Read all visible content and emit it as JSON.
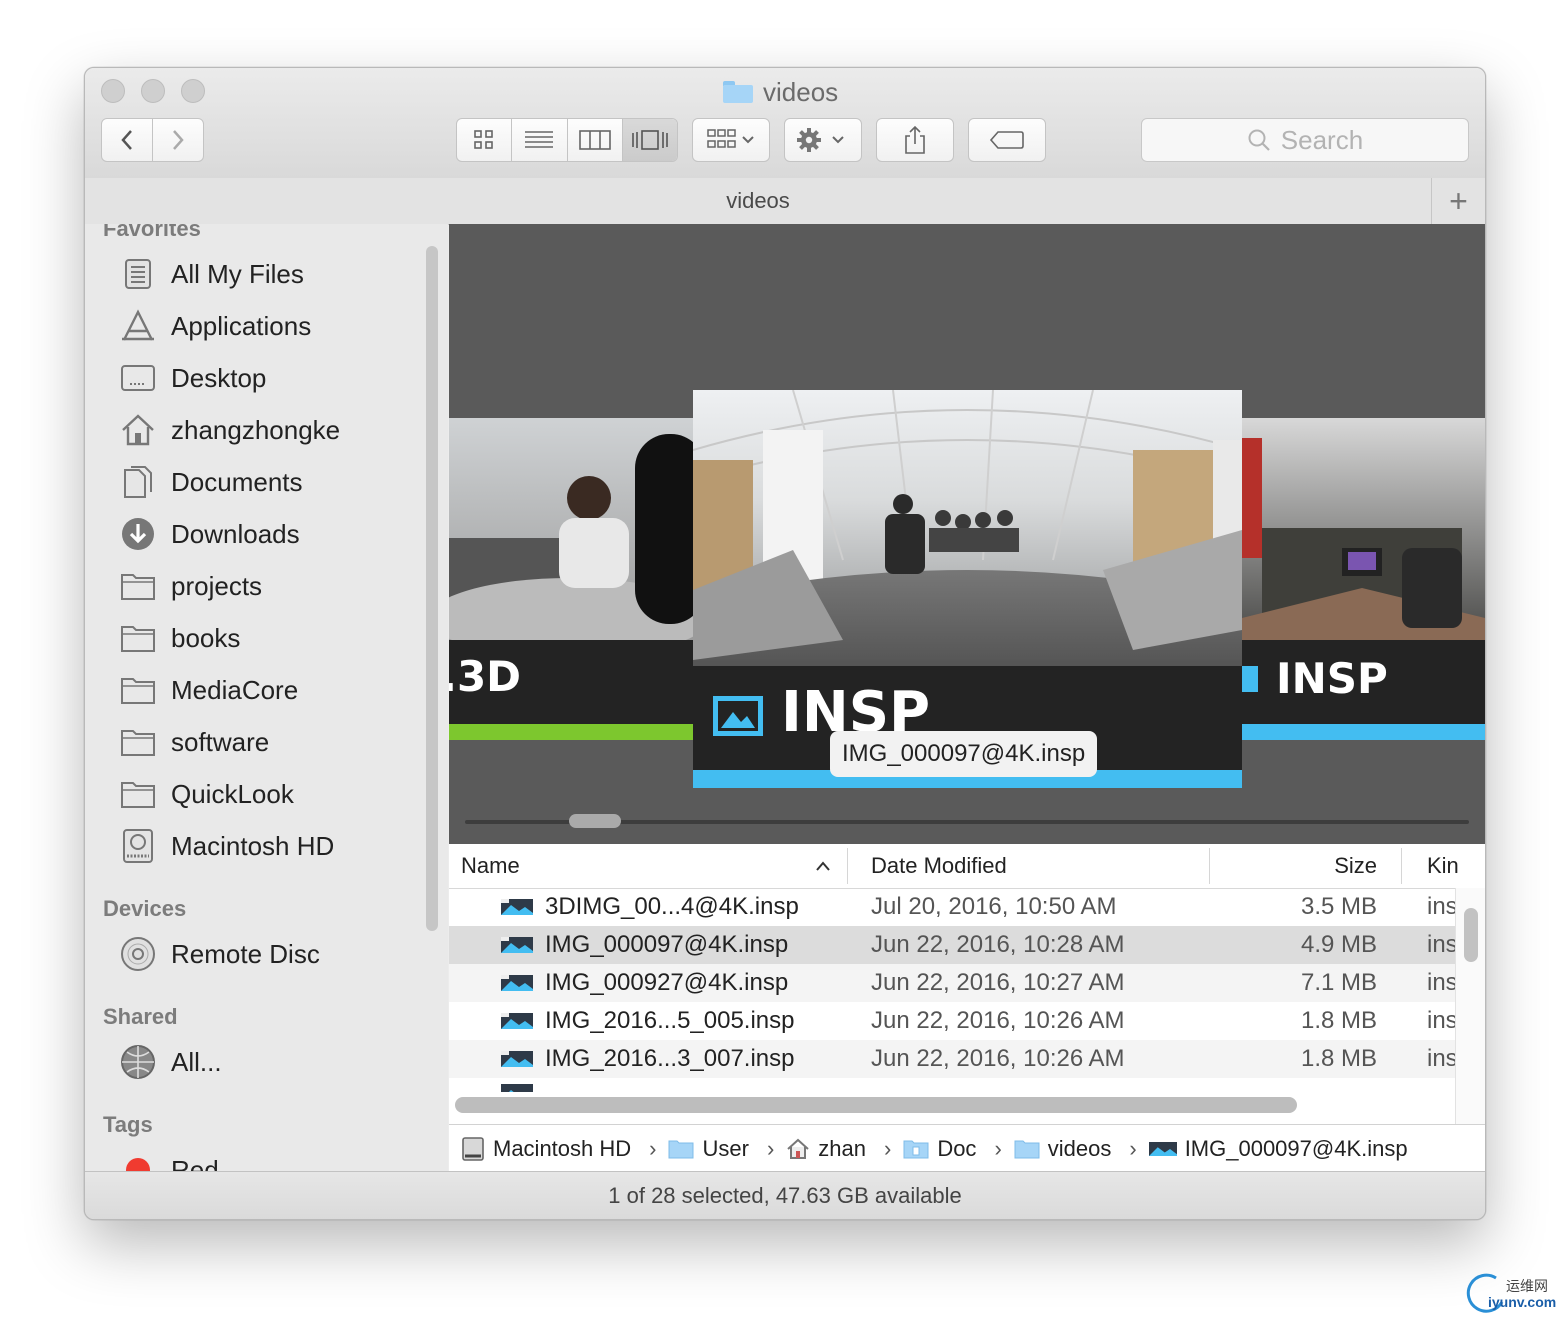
{
  "window": {
    "title": "videos"
  },
  "toolbar": {
    "back_icon": "chevron-left-icon",
    "forward_icon": "chevron-right-icon",
    "view_modes": [
      "icon-view",
      "list-view",
      "column-view",
      "cover-flow-view"
    ],
    "active_view": "cover-flow-view",
    "search_placeholder": "Search"
  },
  "tabbar": {
    "label": "videos"
  },
  "sidebar": {
    "sections": {
      "favorites": "Favorites",
      "devices": "Devices",
      "shared": "Shared",
      "tags": "Tags"
    },
    "favorites": [
      {
        "label": "All My Files",
        "icon": "all-files-icon"
      },
      {
        "label": "Applications",
        "icon": "applications-icon"
      },
      {
        "label": "Desktop",
        "icon": "desktop-icon"
      },
      {
        "label": "zhangzhongke",
        "icon": "home-icon"
      },
      {
        "label": "Documents",
        "icon": "documents-icon"
      },
      {
        "label": "Downloads",
        "icon": "downloads-icon"
      },
      {
        "label": "projects",
        "icon": "folder-icon"
      },
      {
        "label": "books",
        "icon": "folder-icon"
      },
      {
        "label": "MediaCore",
        "icon": "folder-icon"
      },
      {
        "label": "software",
        "icon": "folder-icon"
      },
      {
        "label": "QuickLook",
        "icon": "folder-icon"
      },
      {
        "label": "Macintosh HD",
        "icon": "hard-drive-icon"
      }
    ],
    "devices": [
      {
        "label": "Remote Disc",
        "icon": "disc-icon"
      }
    ],
    "shared": [
      {
        "label": "All...",
        "icon": "network-icon"
      }
    ],
    "tags": [
      {
        "label": "Red",
        "color": "#f03b30"
      }
    ]
  },
  "coverflow": {
    "left_label": ".3D",
    "center_label": "INSP",
    "right_label": "INSP",
    "tooltip": "IMG_000097@4K.insp",
    "colors": {
      "green": "#7dc72e",
      "blue": "#43bdf1"
    }
  },
  "list": {
    "columns": {
      "name": "Name",
      "date": "Date Modified",
      "size": "Size",
      "kind": "Kin"
    },
    "sort_column": "name",
    "sort_direction": "ascending",
    "rows": [
      {
        "name": "3DIMG_00...4@4K.insp",
        "date": "Jul 20, 2016, 10:50 AM",
        "size": "3.5 MB",
        "kind": "ins"
      },
      {
        "name": "IMG_000097@4K.insp",
        "date": "Jun 22, 2016, 10:28 AM",
        "size": "4.9 MB",
        "kind": "ins"
      },
      {
        "name": "IMG_000927@4K.insp",
        "date": "Jun 22, 2016, 10:27 AM",
        "size": "7.1 MB",
        "kind": "ins"
      },
      {
        "name": "IMG_2016...5_005.insp",
        "date": "Jun 22, 2016, 10:26 AM",
        "size": "1.8 MB",
        "kind": "ins"
      },
      {
        "name": "IMG_2016...3_007.insp",
        "date": "Jun 22, 2016, 10:26 AM",
        "size": "1.8 MB",
        "kind": "ins"
      }
    ],
    "selected_row": 1
  },
  "pathbar": [
    {
      "label": "Macintosh HD",
      "icon": "hard-drive-icon"
    },
    {
      "label": "User",
      "icon": "folder-icon"
    },
    {
      "label": "zhan",
      "icon": "home-icon"
    },
    {
      "label": "Doc",
      "icon": "documents-folder-icon"
    },
    {
      "label": "videos",
      "icon": "folder-icon"
    },
    {
      "label": "IMG_000097@4K.insp",
      "icon": "insp-file-icon"
    }
  ],
  "status": {
    "text": "1 of 28 selected, 47.63 GB available"
  },
  "watermark": {
    "line1": "运维网",
    "line2": "iyunv.com"
  }
}
